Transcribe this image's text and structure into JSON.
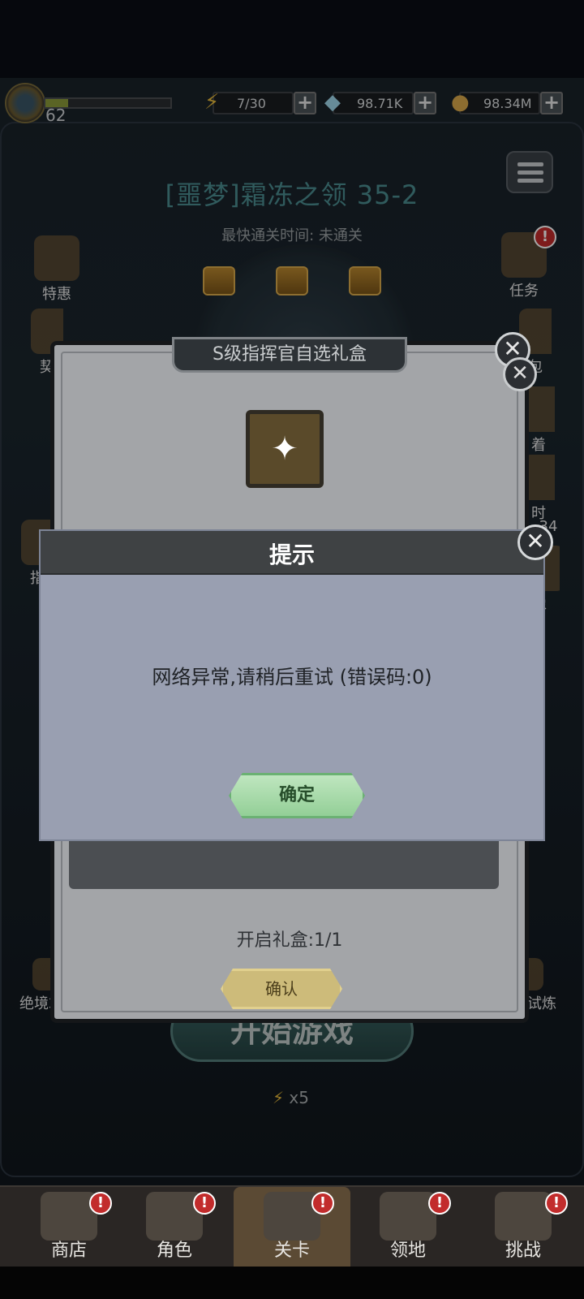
{
  "resources": {
    "level": "62",
    "xp_fraction": 0.18,
    "energy": "7/30",
    "diamonds": "98.71K",
    "coins": "98.34M"
  },
  "stage": {
    "title": "[噩梦]霜冻之领 35-2",
    "fastest_time": "最快通关时间:  未通关"
  },
  "left_side": {
    "item1": "特惠",
    "item2": "契",
    "item3": "指",
    "item4": "绝境求生"
  },
  "right_side": {
    "item1": "任务",
    "item2": "包",
    "item3": "着",
    "item4": "时",
    "item4_count": "34",
    "item5": "像",
    "item6": "精英试炼"
  },
  "start_button": "开始游戏",
  "energy_cost": "x5",
  "gift_modal": {
    "title": "S级指挥官自选礼盒",
    "open_count": "开启礼盒:1/1",
    "confirm_label": "确认"
  },
  "dialog": {
    "title": "提示",
    "message": "网络异常,请稍后重试 (错误码:0)",
    "ok_label": "确定"
  },
  "bottom_nav": [
    {
      "label": "商店"
    },
    {
      "label": "角色"
    },
    {
      "label": "关卡"
    },
    {
      "label": "领地"
    },
    {
      "label": "挑战"
    }
  ]
}
